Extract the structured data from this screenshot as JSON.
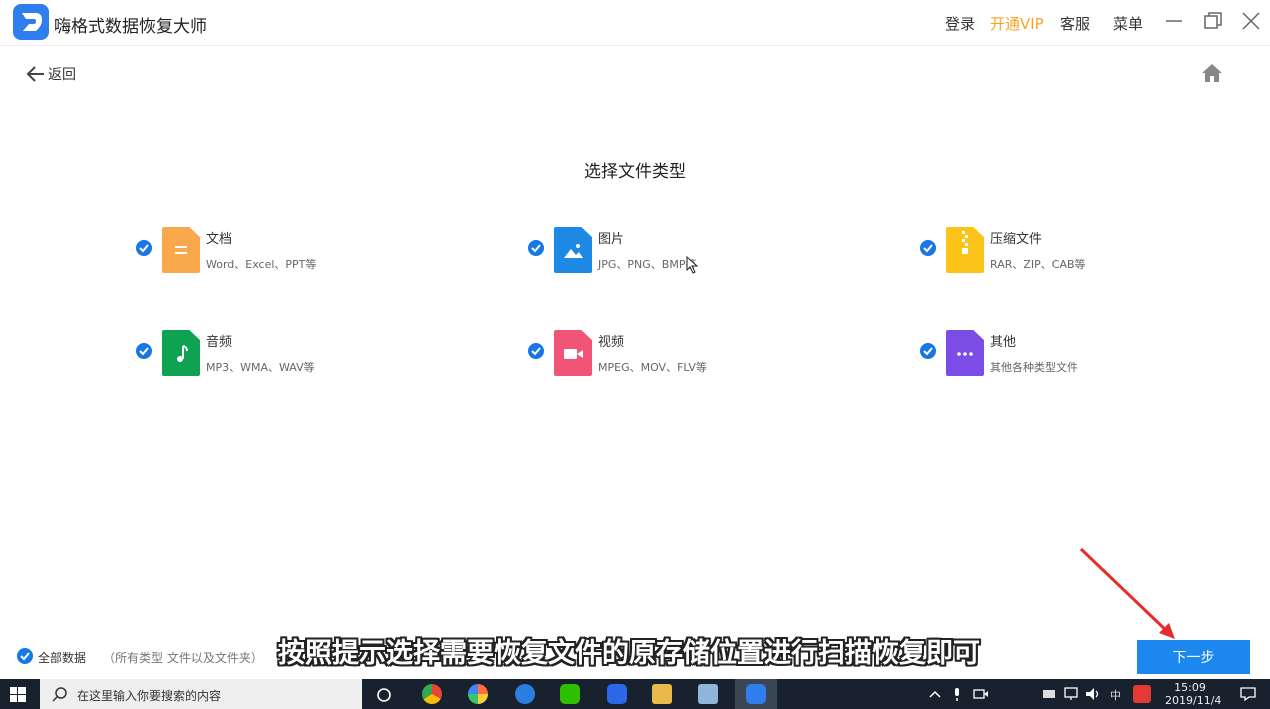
{
  "app": {
    "title": "嗨格式数据恢复大师",
    "menu": {
      "login": "登录",
      "vip": "开通VIP",
      "service": "客服",
      "menu": "菜单"
    }
  },
  "nav": {
    "back_label": "返回"
  },
  "section_title": "选择文件类型",
  "file_types": [
    {
      "name": "文档",
      "desc": "Word、Excel、PPT等",
      "icon": "document-icon",
      "color": "#f9a94b",
      "checked": true
    },
    {
      "name": "图片",
      "desc": "JPG、PNG、BMP等",
      "icon": "image-icon",
      "color": "#1e88e5",
      "checked": true
    },
    {
      "name": "压缩文件",
      "desc": "RAR、ZIP、CAB等",
      "icon": "archive-icon",
      "color": "#fcc419",
      "checked": true
    },
    {
      "name": "音频",
      "desc": "MP3、WMA、WAV等",
      "icon": "music-icon",
      "color": "#10a253",
      "checked": true
    },
    {
      "name": "视频",
      "desc": "MPEG、MOV、FLV等",
      "icon": "video-icon",
      "color": "#f25478",
      "checked": true
    },
    {
      "name": "其他",
      "desc": "其他各种类型文件",
      "icon": "more-icon",
      "color": "#7b4de6",
      "checked": true
    }
  ],
  "all_data": {
    "label": "全部数据",
    "sub": "（所有类型 文件以及文件夹）",
    "checked": true
  },
  "subtitle": "按照提示选择需要恢复文件的原存储位置进行扫描恢复即可",
  "next_button": "下一步",
  "taskbar": {
    "search_placeholder": "在这里输入你要搜索的内容",
    "ime": "中",
    "time": "15:09",
    "date": "2019/11/4"
  },
  "colors": {
    "accent": "#1d87f0",
    "vip": "#f5a623",
    "arrow": "#e82c2c"
  }
}
